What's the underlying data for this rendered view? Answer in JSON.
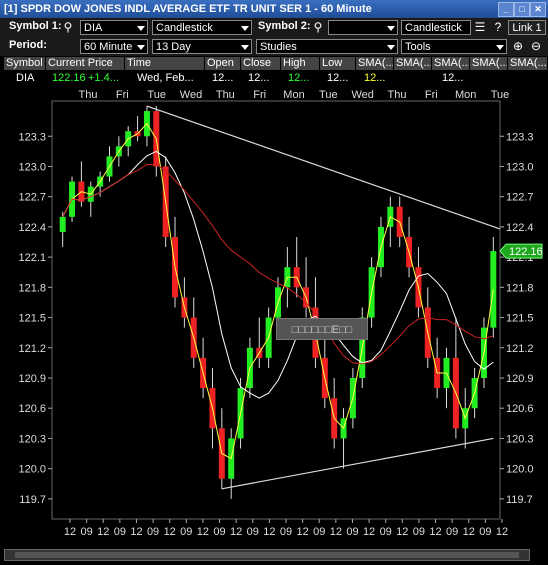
{
  "window": {
    "title": "[1] SPDR DOW JONES INDL AVERAGE ETF TR UNIT SER 1 - 60 Minute"
  },
  "toolbar1": {
    "symbol1_label": "Symbol 1:",
    "symbol1_value": "DIA",
    "chart_type": "Candlestick",
    "symbol2_label": "Symbol 2:",
    "symbol2_value": "",
    "chart_type2": "Candlestick",
    "link_button": "Link 1"
  },
  "toolbar2": {
    "period_label": "Period:",
    "interval": "60 Minute",
    "range": "13 Day",
    "studies": "Studies",
    "tools": "Tools"
  },
  "quote_grid": {
    "headers": [
      "Symbol",
      "Current Price",
      "Time",
      "Open",
      "Close",
      "High",
      "Low",
      "SMA(...",
      "SMA(...",
      "SMA(...",
      "SMA(...",
      "SMA(..."
    ],
    "row": [
      "DIA",
      "122.16",
      "+1.4...",
      "Wed, Feb...",
      "12...",
      "12...",
      "12...",
      "12...",
      "12...",
      "",
      "12...",
      ""
    ],
    "colors": {
      "up": "#33ff33",
      "yellow": "#ffff33",
      "text": "#ffffff"
    }
  },
  "overlay_label": "□□□□□□E□□",
  "price_tag": "122.16",
  "chart_data": {
    "type": "candlestick",
    "ylim": [
      119.5,
      123.65
    ],
    "y_ticks": [
      "123.3",
      "123.0",
      "122.7",
      "122.4",
      "122.1",
      "121.8",
      "121.5",
      "121.2",
      "120.9",
      "120.6",
      "120.3",
      "120.0",
      "119.7"
    ],
    "y_tick_values": [
      123.3,
      123.0,
      122.7,
      122.4,
      122.1,
      121.8,
      121.5,
      121.2,
      120.9,
      120.6,
      120.3,
      120.0,
      119.7
    ],
    "day_labels": [
      "Thu",
      "Fri",
      "Tue",
      "Wed",
      "Thu",
      "Fri",
      "Mon",
      "Tue",
      "Wed",
      "Thu",
      "Fri",
      "Mon",
      "Tue"
    ],
    "hour_labels": [
      "12",
      "09",
      "12",
      "09",
      "12",
      "09",
      "12",
      "09",
      "12",
      "09",
      "12",
      "09",
      "12",
      "09",
      "12",
      "09",
      "12",
      "09",
      "12",
      "09",
      "12",
      "09",
      "12",
      "09",
      "12",
      "09",
      "12"
    ],
    "last_price": 122.16,
    "colors": {
      "up": "#22ee22",
      "down": "#ee2222",
      "sma_short": "#ffff44",
      "sma_mid": "#ffffff",
      "sma_long": "#cc2222",
      "trend": "#dddddd"
    },
    "candles": [
      [
        122.35,
        122.55,
        122.2,
        122.5
      ],
      [
        122.5,
        122.9,
        122.45,
        122.85
      ],
      [
        122.85,
        123.05,
        122.6,
        122.65
      ],
      [
        122.65,
        122.85,
        122.5,
        122.8
      ],
      [
        122.8,
        122.95,
        122.7,
        122.9
      ],
      [
        122.9,
        123.2,
        122.85,
        123.1
      ],
      [
        123.1,
        123.3,
        123.0,
        123.2
      ],
      [
        123.2,
        123.4,
        123.1,
        123.35
      ],
      [
        123.35,
        123.5,
        123.25,
        123.3
      ],
      [
        123.3,
        123.6,
        123.2,
        123.55
      ],
      [
        123.55,
        123.6,
        122.9,
        123.0
      ],
      [
        123.0,
        123.1,
        122.2,
        122.3
      ],
      [
        122.3,
        122.5,
        121.6,
        121.7
      ],
      [
        121.7,
        121.9,
        121.4,
        121.5
      ],
      [
        121.5,
        121.7,
        121.0,
        121.1
      ],
      [
        121.1,
        121.3,
        120.7,
        120.8
      ],
      [
        120.8,
        121.0,
        120.2,
        120.4
      ],
      [
        120.4,
        120.6,
        119.8,
        119.9
      ],
      [
        119.9,
        120.4,
        119.7,
        120.3
      ],
      [
        120.3,
        120.9,
        120.2,
        120.8
      ],
      [
        120.8,
        121.3,
        120.7,
        121.2
      ],
      [
        121.2,
        121.5,
        121.0,
        121.1
      ],
      [
        121.1,
        121.6,
        121.0,
        121.5
      ],
      [
        121.5,
        121.9,
        121.4,
        121.8
      ],
      [
        121.8,
        122.2,
        121.6,
        122.0
      ],
      [
        122.0,
        122.3,
        121.7,
        121.8
      ],
      [
        121.8,
        122.1,
        121.5,
        121.6
      ],
      [
        121.6,
        121.9,
        121.0,
        121.1
      ],
      [
        121.1,
        121.3,
        120.6,
        120.7
      ],
      [
        120.7,
        120.9,
        120.2,
        120.3
      ],
      [
        120.3,
        120.6,
        120.0,
        120.5
      ],
      [
        120.5,
        121.0,
        120.4,
        120.9
      ],
      [
        120.9,
        121.6,
        120.8,
        121.5
      ],
      [
        121.5,
        122.1,
        121.4,
        122.0
      ],
      [
        122.0,
        122.5,
        121.9,
        122.4
      ],
      [
        122.4,
        122.7,
        122.2,
        122.6
      ],
      [
        122.6,
        122.7,
        122.2,
        122.3
      ],
      [
        122.3,
        122.5,
        121.9,
        122.0
      ],
      [
        122.0,
        122.2,
        121.5,
        121.6
      ],
      [
        121.6,
        121.8,
        121.0,
        121.1
      ],
      [
        121.1,
        121.3,
        120.7,
        120.8
      ],
      [
        120.8,
        121.2,
        120.6,
        121.1
      ],
      [
        121.1,
        121.5,
        120.3,
        120.4
      ],
      [
        120.4,
        120.8,
        120.2,
        120.6
      ],
      [
        120.6,
        121.0,
        120.5,
        120.9
      ],
      [
        120.9,
        121.5,
        120.8,
        121.4
      ],
      [
        121.4,
        122.3,
        121.3,
        122.16
      ]
    ]
  }
}
